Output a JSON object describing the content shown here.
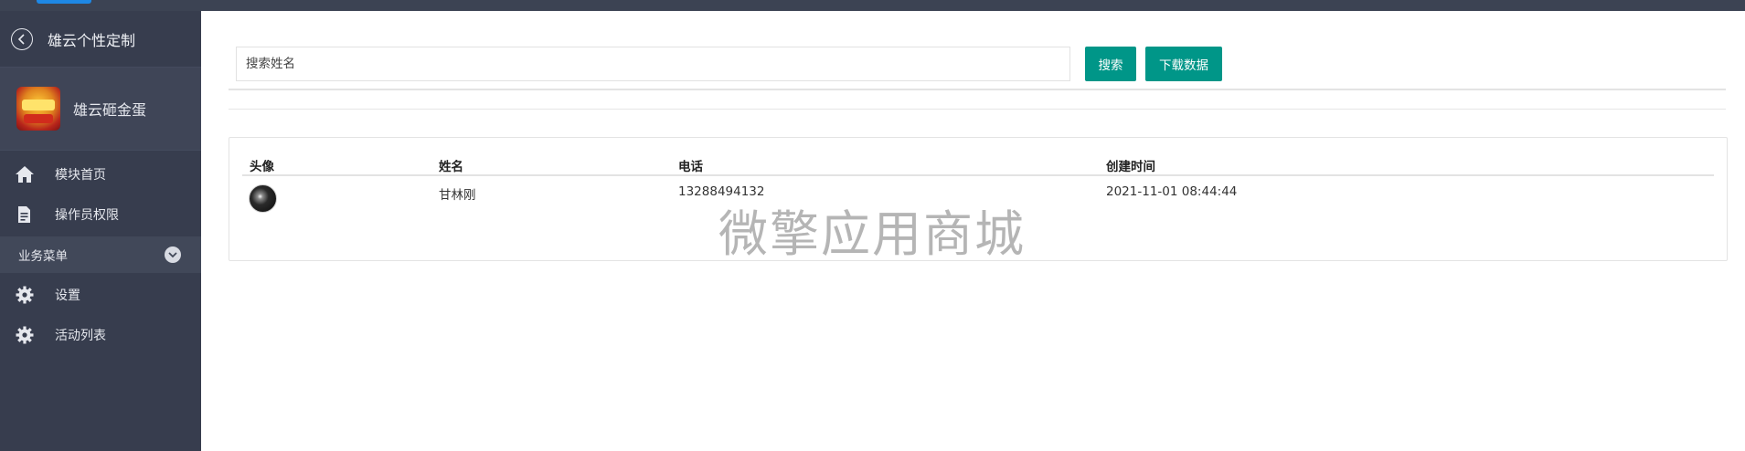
{
  "sidebar": {
    "back_title": "雄云个性定制",
    "brand_name": "雄云砸金蛋",
    "items": [
      {
        "label": "模块首页",
        "icon": "home-icon"
      },
      {
        "label": "操作员权限",
        "icon": "document-edit-icon"
      }
    ],
    "group_label": "业务菜单",
    "group_items": [
      {
        "label": "设置",
        "icon": "gear-icon"
      },
      {
        "label": "活动列表",
        "icon": "gear-icon"
      }
    ]
  },
  "search": {
    "placeholder": "搜索姓名",
    "search_label": "搜索",
    "download_label": "下载数据"
  },
  "table": {
    "headers": [
      "头像",
      "姓名",
      "电话",
      "创建时间"
    ],
    "rows": [
      {
        "name": "甘林刚",
        "phone": "13288494132",
        "created": "2021-11-01 08:44:44"
      }
    ]
  },
  "watermark": "微擎应用商城",
  "colors": {
    "sidebar_bg": "#373d4e",
    "accent": "#009688"
  }
}
